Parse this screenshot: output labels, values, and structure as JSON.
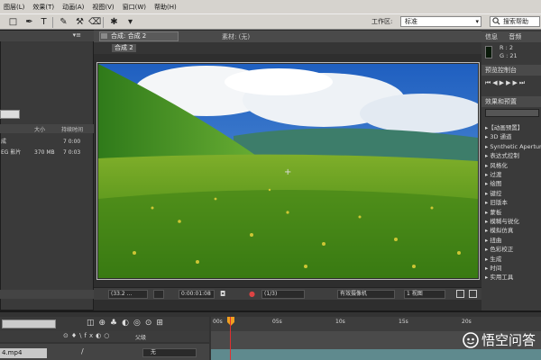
{
  "menu": [
    "图层(L)",
    "效果(T)",
    "动画(A)",
    "视图(V)",
    "窗口(W)",
    "帮助(H)"
  ],
  "toolbar": {
    "workspace_label": "工作区:",
    "workspace_value": "标准",
    "search_placeholder": "搜索帮助"
  },
  "project": {
    "columns": [
      "大小",
      "持续时间"
    ],
    "rows": [
      {
        "name": "成",
        "size": "",
        "duration": "7 0:00"
      },
      {
        "name": "EG 影片",
        "size": "370 MB",
        "duration": "7 0:03"
      }
    ]
  },
  "comp": {
    "tab": "合成: 合成 2",
    "footage_tab": "素材: (无)",
    "breadcrumb": "合成 2",
    "zoom": "(33.2 ...",
    "timecode": "0:00:01:08",
    "resolution": "(1/3)",
    "camera": "有效摄像机",
    "views": "1 视图"
  },
  "info": {
    "tabs": [
      "信息",
      "音频"
    ],
    "r": "R : 2",
    "g": "G : 21"
  },
  "preview_tab": "预览控制台",
  "effects_tab": "效果和预置",
  "effects": [
    "▸【动画预置】",
    "▸ 3D 通道",
    "▸ Synthetic Aperture",
    "▸ 表达式控制",
    "▸ 风格化",
    "▸ 过渡",
    "▸ 绘图",
    "▸ 键控",
    "▸ 旧版本",
    "▸ 蒙板",
    "▸ 模糊与锐化",
    "▸ 模拟仿真",
    "▸ 扭曲",
    "▸ 色彩校正",
    "▸ 生成",
    "▸ 时间",
    "▸ 实用工具"
  ],
  "timeline": {
    "layer_name": "4.mp4",
    "layer_label": "父级",
    "parent_value": "无",
    "ruler": [
      "00s",
      "05s",
      "10s",
      "15s",
      "20s"
    ]
  },
  "watermark": "悟空问答",
  "colors": {
    "accent": "#f0a020",
    "clip": "#5f8a8e",
    "playhead": "#e03030"
  }
}
